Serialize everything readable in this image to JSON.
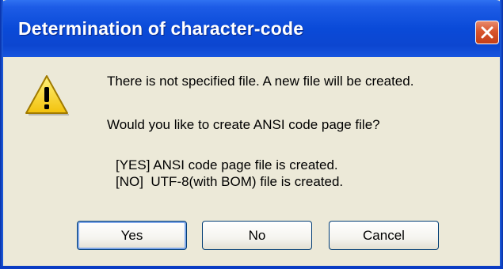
{
  "window": {
    "title": "Determination of character-code",
    "close_icon": "close-icon"
  },
  "icon": "warning-icon",
  "message": {
    "line1": "There is not specified file. A new file will be created.",
    "line2": "Would you like to create ANSI code page file?",
    "line3": "[YES] ANSI code page file is created.",
    "line4": "[NO]  UTF-8(with BOM) file is created."
  },
  "buttons": {
    "yes": "Yes",
    "no": "No",
    "cancel": "Cancel"
  },
  "colors": {
    "titlebar": "#0a4ad8",
    "dialog_bg": "#ece9d8",
    "close_button": "#d8552e",
    "warning": "#f7d21e"
  }
}
